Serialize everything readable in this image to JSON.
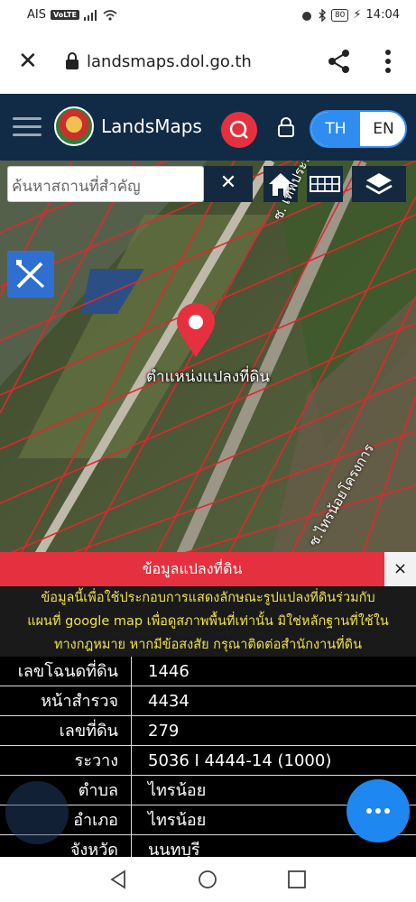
{
  "status_bar": {
    "carrier": "AIS",
    "volte": "VoLTE",
    "battery": "80",
    "time": "14:04"
  },
  "browser": {
    "url": "landsmaps.dol.go.th"
  },
  "app_header": {
    "brand": "LandsMaps",
    "lang_th": "TH",
    "lang_en": "EN",
    "accent": "#e5313f",
    "lang_active_color": "#2f8df0"
  },
  "map": {
    "search_placeholder": "ค้นหาสถานที่สำคัญ",
    "clear_label": "✕",
    "pin_label": "ตำแหน่งแปลงที่ดิน",
    "street_top": "ซ. เทพประทาน",
    "street_bottom": "ซ.ไทรน้อยโครงการ"
  },
  "panel": {
    "title": "ข้อมูลแปลงที่ดิน",
    "close_label": "×",
    "notice_line1": "ข้อมูลนี้เพื่อใช้ประกอบการแสดงลักษณะรูปแปลงที่ดินร่วมกับ",
    "notice_line2": "แผนที่ google map เพื่อดูสภาพพื้นที่เท่านั้น มิใช่หลักฐานที่ใช้ใน",
    "notice_line3": "ทางกฎหมาย หากมีข้อสงสัย กรุณาติดต่อสำนักงานที่ดิน",
    "rows": [
      {
        "key": "เลขโฉนดที่ดิน",
        "value": "1446"
      },
      {
        "key": "หน้าสำรวจ",
        "value": "4434"
      },
      {
        "key": "เลขที่ดิน",
        "value": "279"
      },
      {
        "key": "ระวาง",
        "value": "5036 I 4444-14 (1000)"
      },
      {
        "key": "ตำบล",
        "value": "ไทรน้อย"
      },
      {
        "key": "อำเภอ",
        "value": "ไทรน้อย"
      },
      {
        "key": "จังหวัด",
        "value": "นนทบุรี"
      }
    ]
  }
}
